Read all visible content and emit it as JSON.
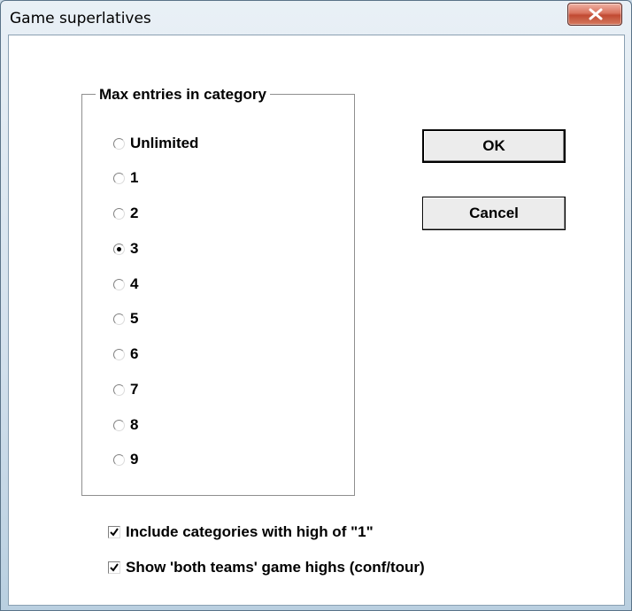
{
  "window": {
    "title": "Game superlatives",
    "close_icon": "close-x-icon"
  },
  "groupbox": {
    "legend": "Max entries in category",
    "options": [
      {
        "label": "Unlimited",
        "checked": false
      },
      {
        "label": "1",
        "checked": false
      },
      {
        "label": "2",
        "checked": false
      },
      {
        "label": "3",
        "checked": true
      },
      {
        "label": "4",
        "checked": false
      },
      {
        "label": "5",
        "checked": false
      },
      {
        "label": "6",
        "checked": false
      },
      {
        "label": "7",
        "checked": false
      },
      {
        "label": "8",
        "checked": false
      },
      {
        "label": "9",
        "checked": false
      }
    ]
  },
  "buttons": {
    "ok_label": "OK",
    "cancel_label": "Cancel"
  },
  "checkboxes": [
    {
      "label": "Include categories with high of \"1\"",
      "checked": true
    },
    {
      "label": "Show 'both teams' game highs (conf/tour)",
      "checked": true
    }
  ]
}
